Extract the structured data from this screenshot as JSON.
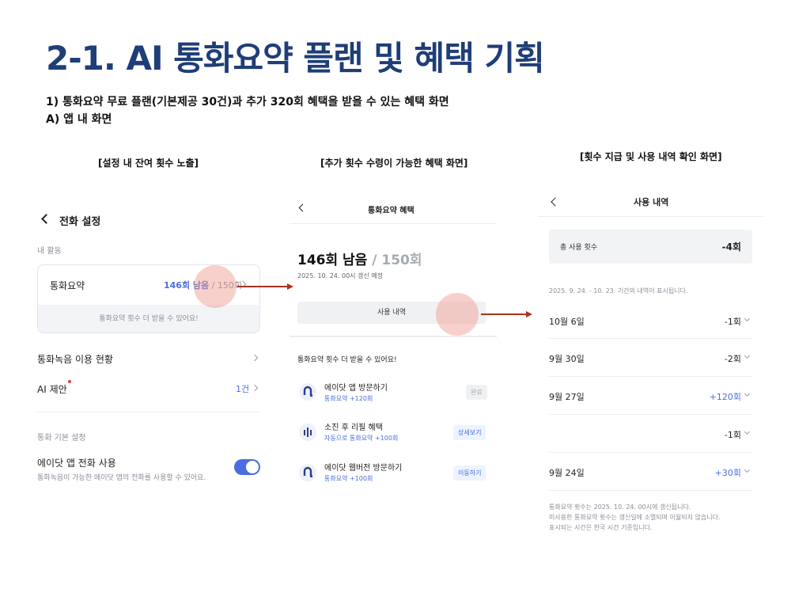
{
  "slide": {
    "title": "2-1. AI 통화요약 플랜 및 혜택 기획",
    "desc_line1": "1) 통화요약 무료 플랜(기본제공 30건)과 추가 320회 혜택을 받을 수 있는 혜택 화면",
    "desc_line2": "A) 앱 내 화면"
  },
  "captions": {
    "screen1": "[설정 내 잔여 횟수 노출]",
    "screen2": "[추가 횟수 수령이 가능한 혜택 화면]",
    "screen3": "[횟수 지급 및 사용 내역 확인 화면]"
  },
  "screen1": {
    "header": "전화 설정",
    "section_activity": "내 활동",
    "card_title": "통화요약",
    "card_count": "146회 남음",
    "card_total": " / 150회",
    "card_footer": "통화요약 횟수 더 받을 수 있어요!",
    "row_recording": "통화녹음 이용 현황",
    "row_ai": "AI 제안",
    "row_ai_count": "1건",
    "section_basic": "통화 기본 설정",
    "toggle_label": "에이닷 앱 전화 사용",
    "toggle_sub": "통화녹음이 가능한 에이닷 앱의 전화를 사용할 수 있어요.",
    "toggle_on": true
  },
  "screen2": {
    "title": "통화요약 혜택",
    "remaining": "146회 남음",
    "total": " / 150회",
    "renew": "2025. 10. 24. 00시 갱신 예정",
    "usage_button": "사용 내역",
    "section_title": "통화요약 횟수 더 받을 수 있어요!",
    "benefits": [
      {
        "name": "에이닷 앱 방문하기",
        "sub": "통화요약 +120회",
        "button": "완료",
        "icon": "aidot-app-icon",
        "state": "done"
      },
      {
        "name": "소진 후 리필 혜택",
        "sub": "자동으로 통화요약 +100회",
        "button": "상세보기",
        "icon": "refill-bars-icon",
        "state": "action"
      },
      {
        "name": "에이닷 웹버전 방문하기",
        "sub": "통화요약 +100회",
        "button": "이동하기",
        "icon": "aidot-web-icon",
        "state": "action"
      }
    ]
  },
  "screen3": {
    "title": "사용 내역",
    "total_label": "총 사용 횟수",
    "total_value": "-4회",
    "period": "2025. 9. 24. - 10. 23. 기간의 내역이 표시됩니다.",
    "history": [
      {
        "date": "10월 6일",
        "value": "-1회",
        "positive": false
      },
      {
        "date": "9월 30일",
        "value": "-2회",
        "positive": false
      },
      {
        "date": "9월 27일",
        "value": "+120회",
        "positive": true
      },
      {
        "date": "",
        "value": "-1회",
        "positive": false
      },
      {
        "date": "9월 24일",
        "value": "+30회",
        "positive": true
      }
    ],
    "notes": [
      "통화요약 횟수는 2025. 10. 24. 00시에 갱신됩니다.",
      "미사용한 통화요약 횟수는 갱신일에 소멸되며 이월되지 않습니다.",
      "표시되는 시간은 한국 시간 기준입니다."
    ]
  },
  "colors": {
    "title": "#1f3e78",
    "accent": "#4a6ee0",
    "highlight": "#f0968c",
    "arrow": "#a8321d"
  }
}
